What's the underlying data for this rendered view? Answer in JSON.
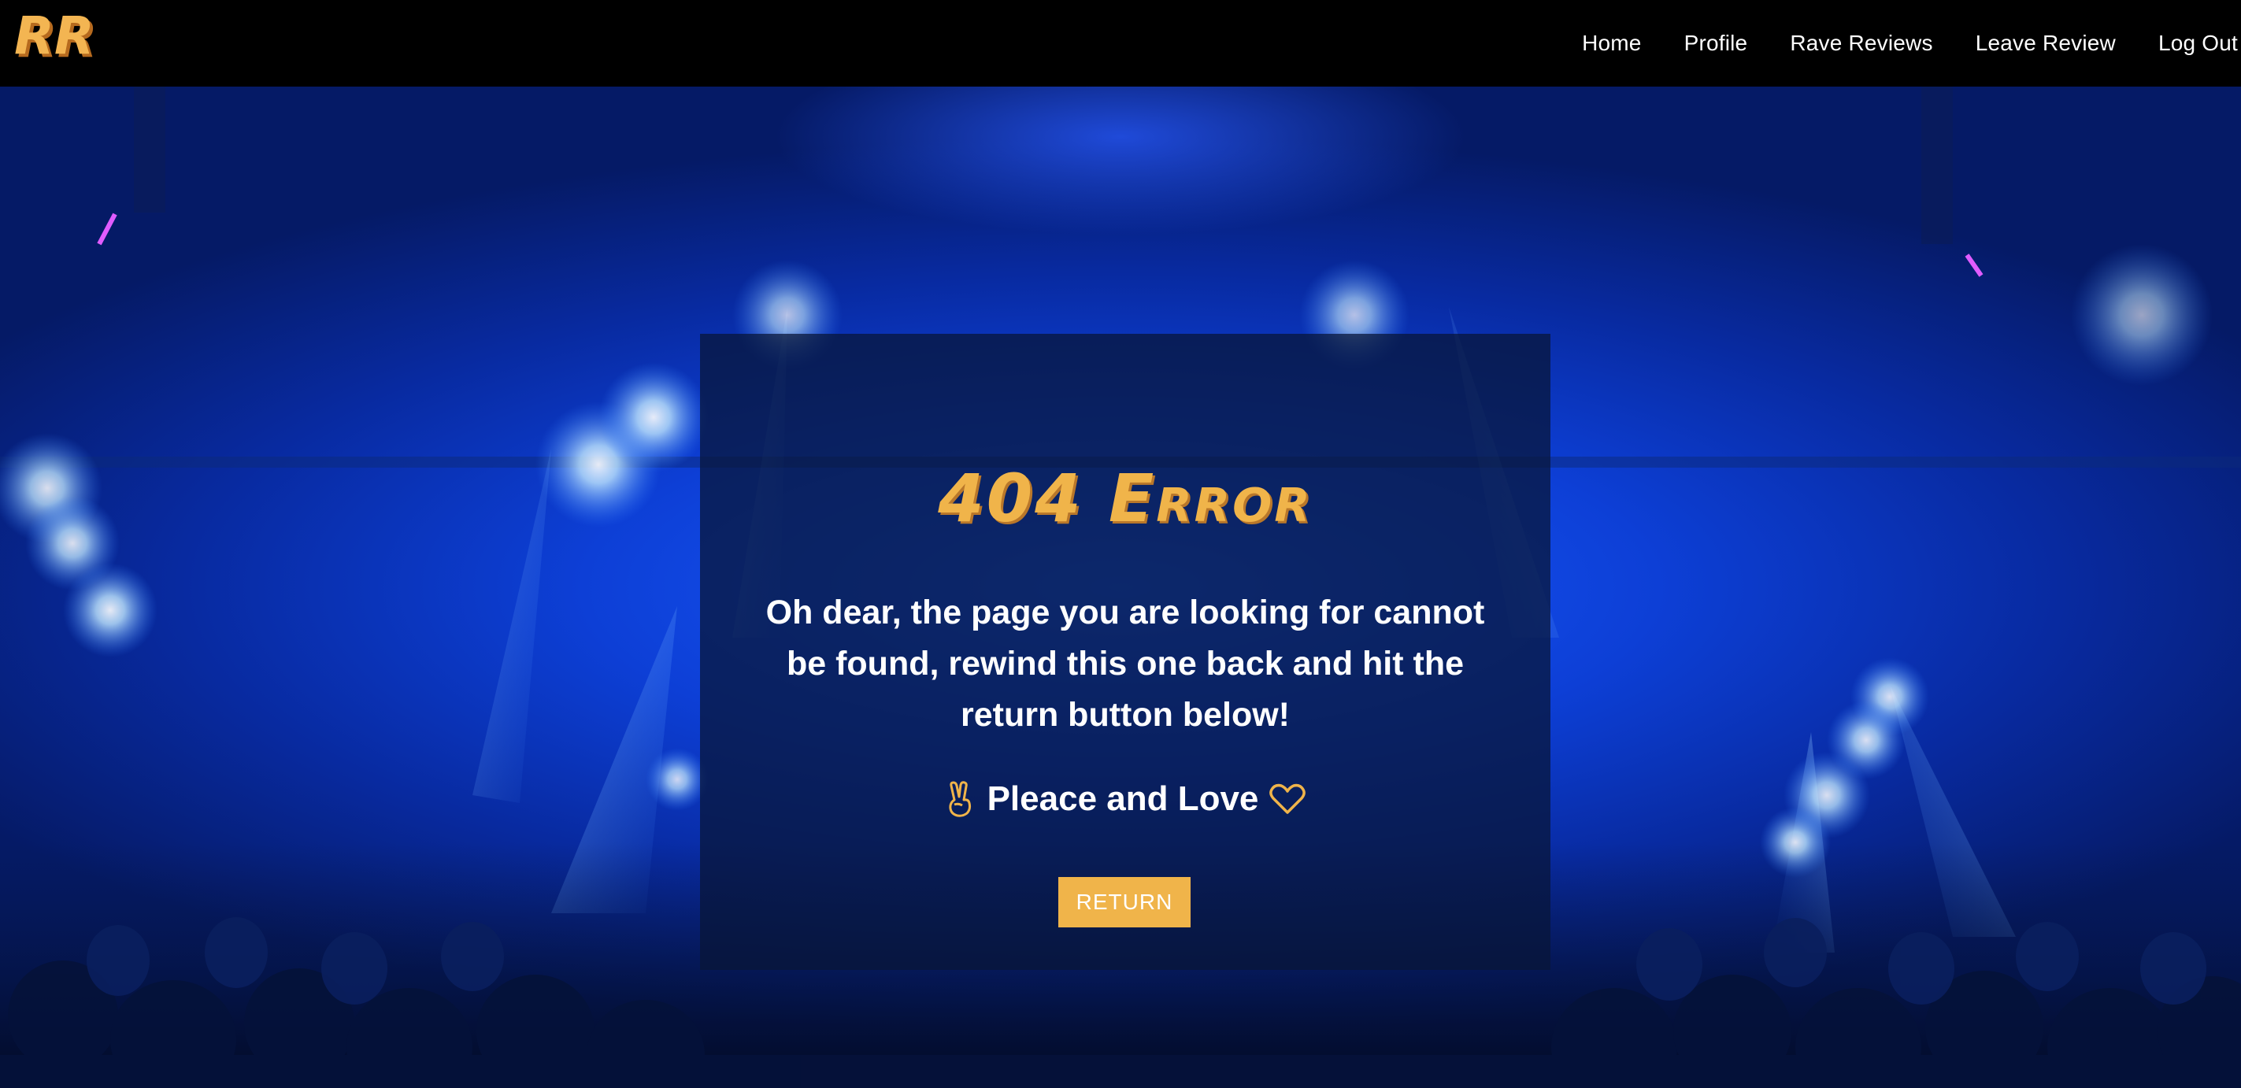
{
  "brand": {
    "logo_text": "RR",
    "logo_color": "#f0b44a"
  },
  "nav": {
    "items": [
      {
        "label": "Home"
      },
      {
        "label": "Profile"
      },
      {
        "label": "Rave Reviews"
      },
      {
        "label": "Leave Review"
      },
      {
        "label": "Log Out"
      }
    ]
  },
  "error": {
    "title": "404 Error",
    "message": "Oh dear, the page you are looking for cannot be found, rewind this one back and hit the return button below!",
    "signoff": "Pleace and Love",
    "icons": [
      "peace-hand-icon",
      "heart-icon"
    ],
    "button_label": "RETURN"
  },
  "colors": {
    "accent": "#f0b44a",
    "navbar": "#000000",
    "card_overlay": "#081637"
  }
}
